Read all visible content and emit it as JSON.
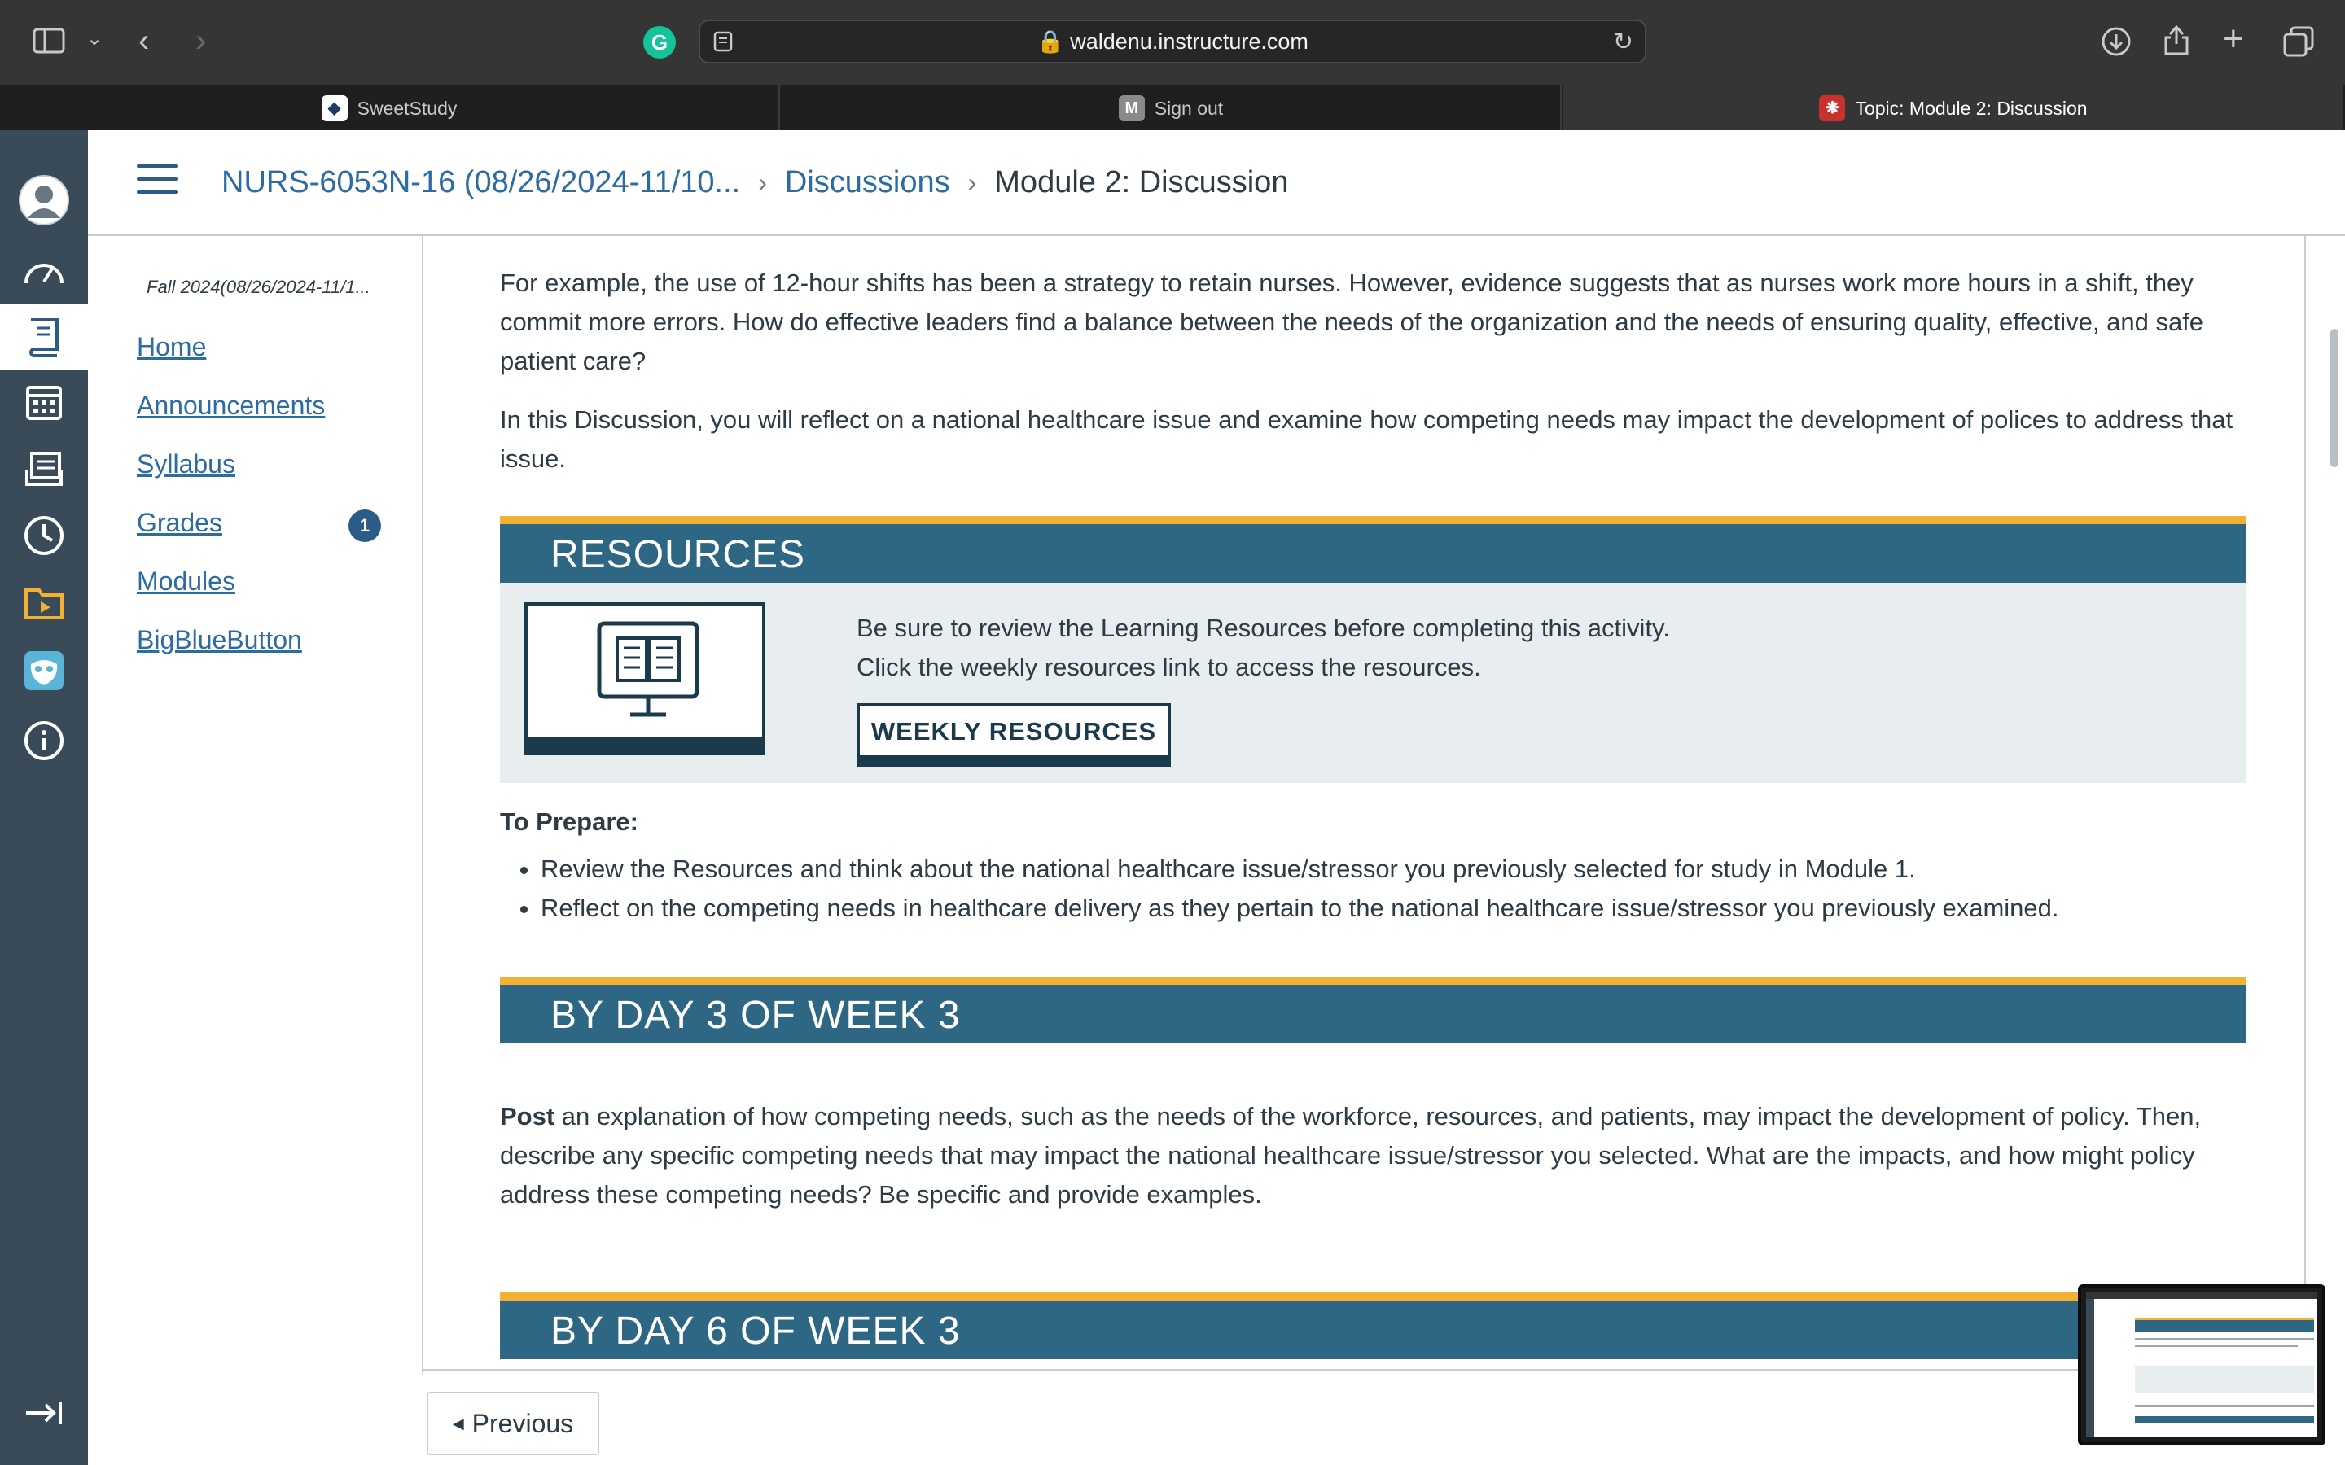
{
  "browser": {
    "url": "waldenu.instructure.com",
    "tabs": [
      {
        "label": "SweetStudy",
        "favicon": "sweetstudy-icon"
      },
      {
        "label": "Sign out",
        "favicon": "m-icon"
      },
      {
        "label": "Topic: Module 2: Discussion",
        "favicon": "walden-icon"
      }
    ]
  },
  "header": {
    "breadcrumbs": [
      "NURS-6053N-16 (08/26/2024-11/10...",
      "Discussions",
      "Module 2: Discussion"
    ]
  },
  "course_nav": {
    "term": "Fall 2024(08/26/2024-11/1...",
    "items": [
      {
        "label": "Home"
      },
      {
        "label": "Announcements"
      },
      {
        "label": "Syllabus"
      },
      {
        "label": "Grades",
        "badge": "1"
      },
      {
        "label": "Modules"
      },
      {
        "label": "BigBlueButton"
      }
    ]
  },
  "content": {
    "para1": "For example, the use of 12-hour shifts has been a strategy to retain nurses. However, evidence suggests that as nurses work more hours in a shift, they commit more errors. How do effective leaders find a balance between the needs of the organization and the needs of ensuring quality, effective, and safe patient care?",
    "para2": "In this Discussion, you will reflect on a national healthcare issue and examine how competing needs may impact the development of polices to address that issue.",
    "resources": {
      "title": "RESOURCES",
      "line1": "Be sure to review the Learning Resources before completing this activity.",
      "line2": "Click the weekly resources link to access the resources.",
      "button": "WEEKLY RESOURCES"
    },
    "prepare_heading": "To Prepare:",
    "prepare_items": [
      "Review the Resources and think about the national healthcare issue/stressor you previously selected for study in Module 1.",
      "Reflect on the competing needs in healthcare delivery as they pertain to the national healthcare issue/stressor you previously examined."
    ],
    "day3": {
      "title": "BY DAY 3 OF WEEK 3",
      "lead": "Post",
      "text": " an explanation of how competing needs, such as the needs of the workforce, resources, and patients, may impact the development of policy. Then, describe any specific competing needs that may impact the national healthcare issue/stressor you selected. What are the impacts, and how might policy address these competing needs? Be specific and provide examples."
    },
    "day6": {
      "title": "BY DAY 6 OF WEEK 3"
    }
  },
  "footer": {
    "previous": "Previous"
  },
  "colors": {
    "banner": "#2e6783",
    "banner_accent": "#f2b132",
    "link": "#2d6ba3",
    "nav_bg": "#394b58"
  }
}
